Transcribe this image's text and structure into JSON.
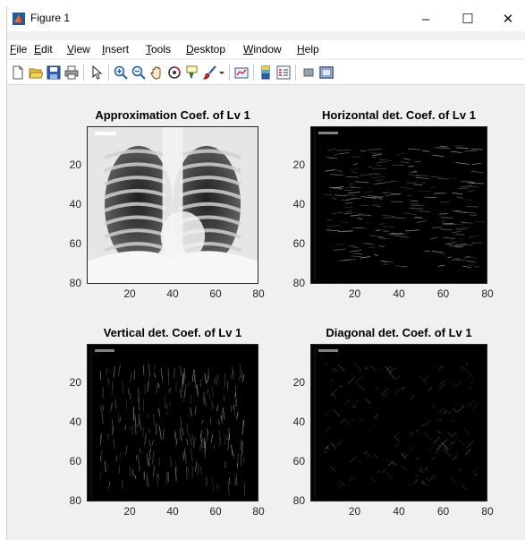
{
  "window": {
    "title": "Figure 1",
    "controls": {
      "minimize": "–",
      "maximize": "☐",
      "close": "✕"
    }
  },
  "menubar": {
    "items": [
      {
        "underline": "F",
        "rest": "ile"
      },
      {
        "underline": "E",
        "rest": "dit"
      },
      {
        "underline": "V",
        "rest": "iew"
      },
      {
        "underline": "I",
        "rest": "nsert"
      },
      {
        "underline": "T",
        "rest": "ools"
      },
      {
        "underline": "D",
        "rest": "esktop"
      },
      {
        "underline": "W",
        "rest": "indow"
      },
      {
        "underline": "H",
        "rest": "elp"
      }
    ]
  },
  "toolbar": {
    "icons": [
      "new-figure-icon",
      "open-file-icon",
      "save-icon",
      "print-icon",
      "pointer-icon",
      "zoom-in-icon",
      "zoom-out-icon",
      "pan-icon",
      "rotate-3d-icon",
      "data-cursor-icon",
      "brush-icon",
      "dropdown-arrow-icon",
      "link-plot-icon",
      "colorbar-icon",
      "legend-icon",
      "hide-plot-tools-icon",
      "show-plot-tools-icon"
    ]
  },
  "axes": [
    {
      "title": "Approximation Coef. of Lv 1",
      "style": "approximation",
      "yticks": [
        "20",
        "40",
        "60",
        "80"
      ],
      "xticks": [
        "20",
        "40",
        "60",
        "80"
      ]
    },
    {
      "title": "Horizontal det. Coef. of Lv 1",
      "style": "horizontal",
      "yticks": [
        "20",
        "40",
        "60",
        "80"
      ],
      "xticks": [
        "20",
        "40",
        "60",
        "80"
      ]
    },
    {
      "title": "Vertical det. Coef. of Lv 1",
      "style": "vertical",
      "yticks": [
        "20",
        "40",
        "60",
        "80"
      ],
      "xticks": [
        "20",
        "40",
        "60",
        "80"
      ]
    },
    {
      "title": "Diagonal det. Coef. of Lv 1",
      "style": "diagonal",
      "yticks": [
        "20",
        "40",
        "60",
        "80"
      ],
      "xticks": [
        "20",
        "40",
        "60",
        "80"
      ]
    }
  ],
  "colors": {
    "window_bg": "#f0f0f0",
    "plot_bg": "#000000",
    "accent": "#0078d7"
  }
}
